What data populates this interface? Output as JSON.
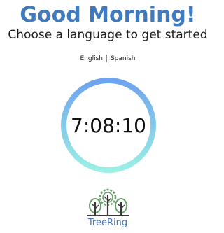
{
  "greeting": {
    "title": "Good Morning!",
    "subtitle": "Choose a language to get started"
  },
  "language_switch": {
    "options": [
      "English",
      "Spanish"
    ]
  },
  "clock": {
    "time": "7:08:10",
    "ring_gradient_top": "#6ea3ef",
    "ring_gradient_bottom": "#9af0e4"
  },
  "logo": {
    "name": "TreeRing",
    "icon": "tree-ring-logo-icon"
  },
  "colors": {
    "accent": "#3f79c0",
    "logo_green": "#6a9e6a",
    "text": "#1b1b1b"
  }
}
